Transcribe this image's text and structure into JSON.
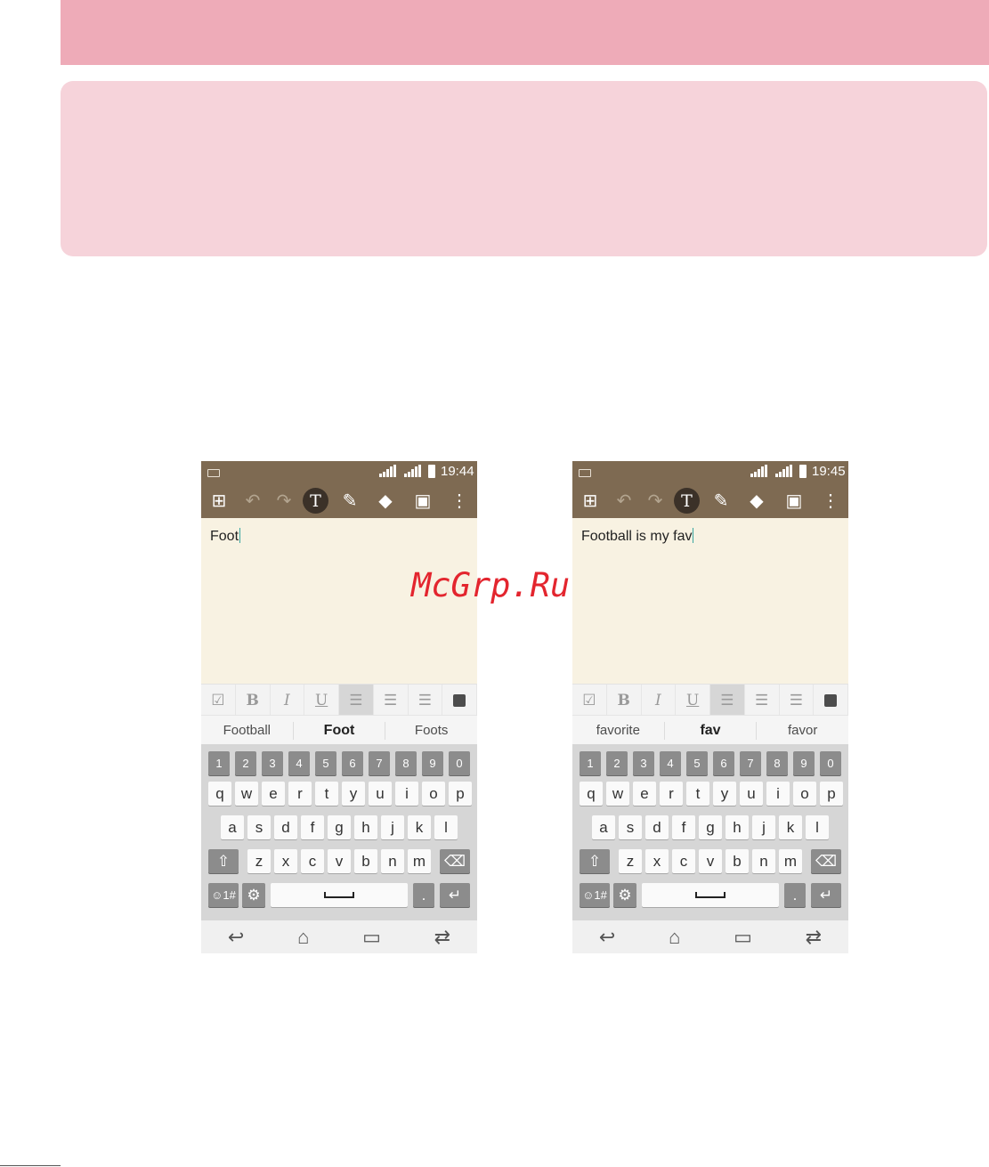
{
  "watermark": "McGrp.Ru",
  "screens": [
    {
      "time": "19:44",
      "note_text": "Foot",
      "suggestions": [
        "Football",
        "Foot",
        "Foots"
      ]
    },
    {
      "time": "19:45",
      "note_text": "Football is my fav",
      "suggestions": [
        "favorite",
        "fav",
        "favor"
      ]
    }
  ],
  "format_bar": {
    "checkbox": "☑",
    "bold": "B",
    "italic": "I",
    "underline": "U",
    "align_left": "☰",
    "align_center": "☰",
    "align_right": "☰"
  },
  "toolbar_icons": [
    "view-icon",
    "undo-icon",
    "redo-icon",
    "text-tool-icon",
    "pen-icon",
    "eraser-icon",
    "save-icon",
    "more-icon"
  ],
  "toolbar_glyphs": {
    "view": "⊞",
    "undo": "↶",
    "redo": "↷",
    "text": "T",
    "pen": "✎",
    "eraser": "◆",
    "save": "▣",
    "more": "⋮"
  },
  "keyboard": {
    "numbers": [
      "1",
      "2",
      "3",
      "4",
      "5",
      "6",
      "7",
      "8",
      "9",
      "0"
    ],
    "row1": [
      "q",
      "w",
      "e",
      "r",
      "t",
      "y",
      "u",
      "i",
      "o",
      "p"
    ],
    "row2": [
      "a",
      "s",
      "d",
      "f",
      "g",
      "h",
      "j",
      "k",
      "l"
    ],
    "row3": [
      "z",
      "x",
      "c",
      "v",
      "b",
      "n",
      "m"
    ],
    "shift": "⇧",
    "backspace": "⌫",
    "symbols": "☺1#",
    "settings": "⚙",
    "period": ".",
    "enter": "↵"
  },
  "nav_glyphs": {
    "back": "↩",
    "home": "⌂",
    "recents": "▭",
    "dual": "⇄"
  },
  "colors": {
    "toolbar": "#7e6a52",
    "note_background": "#f8f2e2",
    "header_band": "#eeabb8",
    "info_box": "#f6d3da",
    "watermark": "#e3252e"
  }
}
